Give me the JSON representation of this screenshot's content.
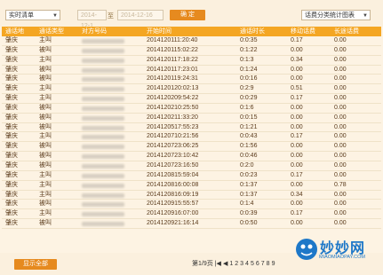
{
  "toolbar": {
    "report_select": "实时清单",
    "date_start_placeholder": "2014-12-1",
    "date_sep": "至",
    "date_end_placeholder": "2014-12-16",
    "confirm_label": "确 定",
    "chart_select": "话费分类统计图表"
  },
  "table": {
    "headers": [
      "通话地",
      "通话类型",
      "对方号码",
      "开始时间",
      "通话时长",
      "移动话费",
      "长途话费"
    ],
    "rows": [
      [
        "肇庆",
        "主叫",
        "2014120111:20:40",
        "0:0:35",
        "0.17",
        "0.00"
      ],
      [
        "肇庆",
        "被叫",
        "2014120115:02:22",
        "0:1:22",
        "0.00",
        "0.00"
      ],
      [
        "肇庆",
        "主叫",
        "2014120117:18:22",
        "0:1:3",
        "0.34",
        "0.00"
      ],
      [
        "肇庆",
        "被叫",
        "2014120117:23:01",
        "0:1:24",
        "0.00",
        "0.00"
      ],
      [
        "肇庆",
        "被叫",
        "2014120119:24:31",
        "0:0:16",
        "0.00",
        "0.00"
      ],
      [
        "肇庆",
        "主叫",
        "2014120120:02:13",
        "0:2:9",
        "0.51",
        "0.00"
      ],
      [
        "肇庆",
        "主叫",
        "2014120209:54:22",
        "0:0:29",
        "0.17",
        "0.00"
      ],
      [
        "肇庆",
        "被叫",
        "2014120210:25:50",
        "0:1:6",
        "0.00",
        "0.00"
      ],
      [
        "肇庆",
        "被叫",
        "2014120211:33:20",
        "0:0:15",
        "0.00",
        "0.00"
      ],
      [
        "肇庆",
        "被叫",
        "2014120517:55:23",
        "0:1:21",
        "0.00",
        "0.00"
      ],
      [
        "肇庆",
        "主叫",
        "2014120710:21:56",
        "0:0:43",
        "0.17",
        "0.00"
      ],
      [
        "肇庆",
        "被叫",
        "2014120723:06:25",
        "0:1:56",
        "0.00",
        "0.00"
      ],
      [
        "肇庆",
        "被叫",
        "2014120723:10:42",
        "0:0:46",
        "0.00",
        "0.00"
      ],
      [
        "肇庆",
        "被叫",
        "2014120723:16:50",
        "0:2:0",
        "0.00",
        "0.00"
      ],
      [
        "肇庆",
        "主叫",
        "2014120815:59:04",
        "0:0:23",
        "0.17",
        "0.00"
      ],
      [
        "肇庆",
        "主叫",
        "2014120816:00:08",
        "0:1:37",
        "0.00",
        "0.78"
      ],
      [
        "肇庆",
        "主叫",
        "2014120816:09:19",
        "0:1:37",
        "0.34",
        "0.00"
      ],
      [
        "肇庆",
        "被叫",
        "2014120915:55:57",
        "0:1:4",
        "0.00",
        "0.00"
      ],
      [
        "肇庆",
        "主叫",
        "2014120916:07:00",
        "0:0:39",
        "0.17",
        "0.00"
      ],
      [
        "肇庆",
        "被叫",
        "2014120921:16:14",
        "0:0:50",
        "0.00",
        "0.00"
      ]
    ]
  },
  "footer": {
    "show_all_label": "显示全部",
    "page_info": "第1/9页",
    "pages": [
      "1",
      "2",
      "3",
      "4",
      "5",
      "6",
      "7",
      "8",
      "9"
    ]
  },
  "watermark": {
    "name": "妙妙网",
    "url": "MIAOMIAOPAY.COM"
  }
}
